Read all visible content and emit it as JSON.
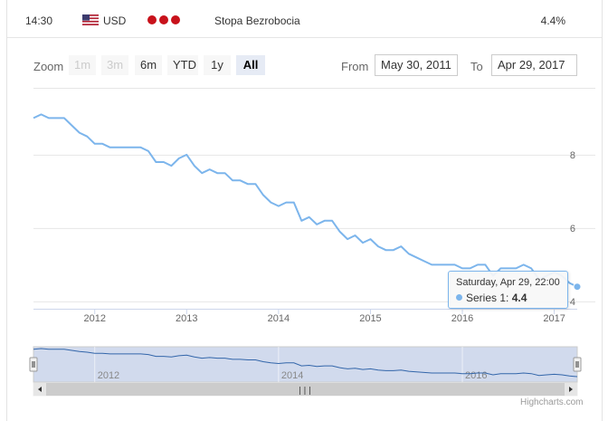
{
  "event": {
    "time": "14:30",
    "currency": "USD",
    "name": "Stopa Bezrobocia",
    "actual": "4.4%",
    "colors": {
      "bull": "#c8121b"
    }
  },
  "toolbar": {
    "zoom_label": "Zoom",
    "buttons": [
      {
        "label": "1m",
        "state": "disabled"
      },
      {
        "label": "3m",
        "state": "disabled"
      },
      {
        "label": "6m",
        "state": "normal"
      },
      {
        "label": "YTD",
        "state": "normal"
      },
      {
        "label": "1y",
        "state": "normal"
      },
      {
        "label": "All",
        "state": "active"
      }
    ],
    "from_label": "From",
    "from_value": "May 30, 2011",
    "to_label": "To",
    "to_value": "Apr 29, 2017"
  },
  "tooltip": {
    "date": "Saturday, Apr 29, 22:00",
    "series_label": "Series 1: ",
    "value": "4.4"
  },
  "navigator": {
    "labels": [
      "2012",
      "2014",
      "2016"
    ],
    "scrollbar_grip": "|||"
  },
  "credits": "Highcharts.com",
  "chart_data": {
    "type": "line",
    "title": "",
    "xlabel": "",
    "ylabel": "",
    "ylim": [
      3.8,
      9.8
    ],
    "y_ticks": [
      4,
      6,
      8
    ],
    "x_tick_labels": [
      "2012",
      "2013",
      "2014",
      "2015",
      "2016",
      "2017"
    ],
    "grid": true,
    "series": [
      {
        "name": "Series 1",
        "color": "#7cb5ec",
        "x": [
          "2011-05",
          "2011-06",
          "2011-07",
          "2011-08",
          "2011-09",
          "2011-10",
          "2011-11",
          "2011-12",
          "2012-01",
          "2012-02",
          "2012-03",
          "2012-04",
          "2012-05",
          "2012-06",
          "2012-07",
          "2012-08",
          "2012-09",
          "2012-10",
          "2012-11",
          "2012-12",
          "2013-01",
          "2013-02",
          "2013-03",
          "2013-04",
          "2013-05",
          "2013-06",
          "2013-07",
          "2013-08",
          "2013-09",
          "2013-10",
          "2013-11",
          "2013-12",
          "2014-01",
          "2014-02",
          "2014-03",
          "2014-04",
          "2014-05",
          "2014-06",
          "2014-07",
          "2014-08",
          "2014-09",
          "2014-10",
          "2014-11",
          "2014-12",
          "2015-01",
          "2015-02",
          "2015-03",
          "2015-04",
          "2015-05",
          "2015-06",
          "2015-07",
          "2015-08",
          "2015-09",
          "2015-10",
          "2015-11",
          "2015-12",
          "2016-01",
          "2016-02",
          "2016-03",
          "2016-04",
          "2016-05",
          "2016-06",
          "2016-07",
          "2016-08",
          "2016-09",
          "2016-10",
          "2016-11",
          "2016-12",
          "2017-01",
          "2017-02",
          "2017-03",
          "2017-04"
        ],
        "values": [
          9.0,
          9.1,
          9.0,
          9.0,
          9.0,
          8.8,
          8.6,
          8.5,
          8.3,
          8.3,
          8.2,
          8.2,
          8.2,
          8.2,
          8.2,
          8.1,
          7.8,
          7.8,
          7.7,
          7.9,
          8.0,
          7.7,
          7.5,
          7.6,
          7.5,
          7.5,
          7.3,
          7.3,
          7.2,
          7.2,
          6.9,
          6.7,
          6.6,
          6.7,
          6.7,
          6.2,
          6.3,
          6.1,
          6.2,
          6.2,
          5.9,
          5.7,
          5.8,
          5.6,
          5.7,
          5.5,
          5.4,
          5.4,
          5.5,
          5.3,
          5.2,
          5.1,
          5.0,
          5.0,
          5.0,
          5.0,
          4.9,
          4.9,
          5.0,
          5.0,
          4.7,
          4.9,
          4.9,
          4.9,
          5.0,
          4.9,
          4.6,
          4.7,
          4.8,
          4.7,
          4.5,
          4.4
        ]
      }
    ]
  }
}
